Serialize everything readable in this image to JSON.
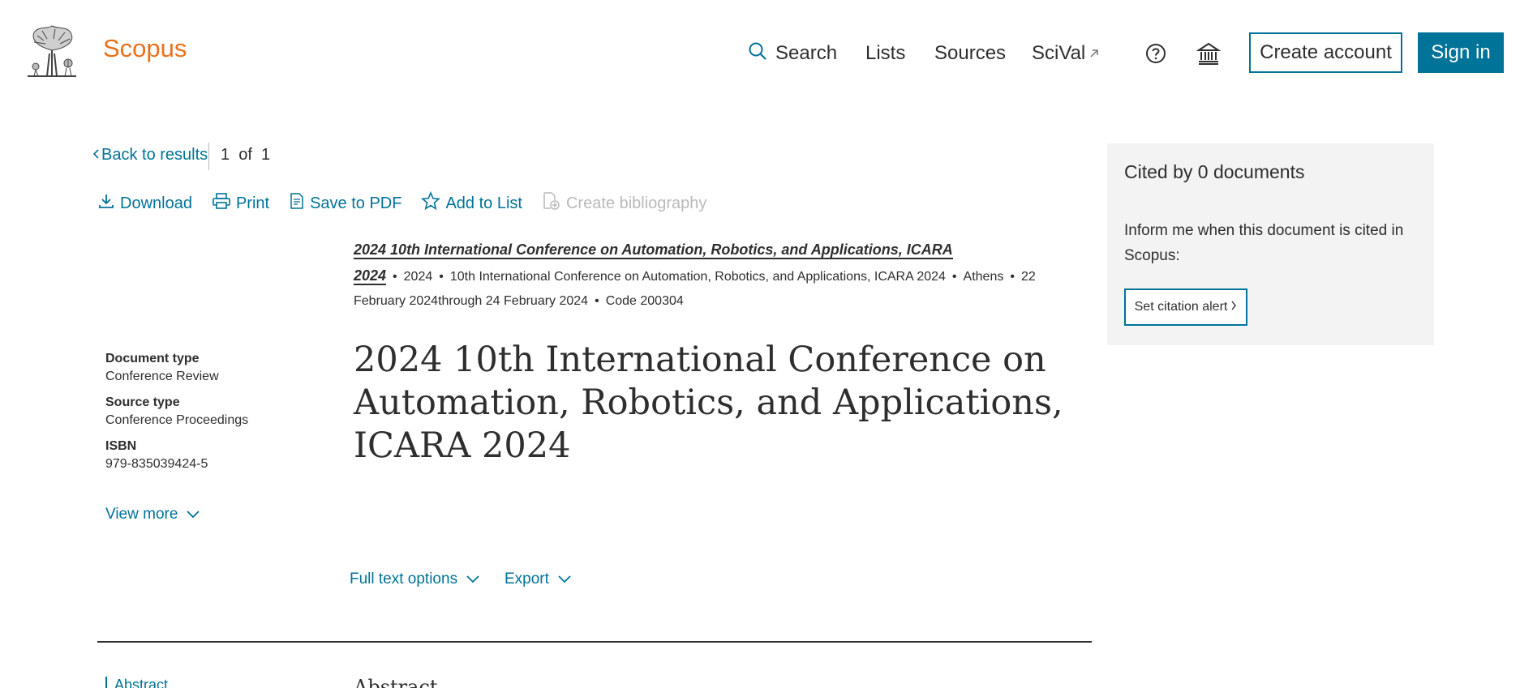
{
  "header": {
    "brand": "Scopus",
    "nav": {
      "search": "Search",
      "lists": "Lists",
      "sources": "Sources",
      "scival": "SciVal"
    },
    "create_account": "Create account",
    "sign_in": "Sign in",
    "icons": [
      "elsevier-logo",
      "search-icon",
      "external-link-icon",
      "help-icon",
      "institution-icon"
    ]
  },
  "back": {
    "label": "Back to results",
    "paging": "1  of  1"
  },
  "toolbar": {
    "download": "Download",
    "print": "Print",
    "save_pdf": "Save to PDF",
    "add_list": "Add to List",
    "create_bibliography": "Create bibliography"
  },
  "source": {
    "title": "2024 10th International Conference on Automation, Robotics, and Applications, ICARA 2024",
    "year": "2024",
    "edition_line": "10th International Conference on Automation, Robotics, and Applications, ICARA 2024",
    "location": "Athens",
    "dates": "22 February 2024through 24 February 2024",
    "code": "Code 200304"
  },
  "document": {
    "title": "2024 10th International Conference on Automation, Robotics, and Applications, ICARA 2024"
  },
  "meta": {
    "doc_type_label": "Document type",
    "doc_type_value": "Conference Review",
    "source_type_label": "Source type",
    "source_type_value": "Conference Proceedings",
    "isbn_label": "ISBN",
    "isbn_value": "979-835039424-5",
    "view_more": "View more"
  },
  "options": {
    "full_text": "Full text options",
    "export": "Export"
  },
  "abstract": {
    "side_link": "Abstract",
    "heading": "Abstract"
  },
  "cited": {
    "title": "Cited by 0 documents",
    "text": "Inform me when this document is cited in Scopus:",
    "alert_button": "Set citation alert"
  },
  "colors": {
    "brand": "#e9711c",
    "link": "#007398",
    "text": "#2e2e2e",
    "panel": "#f3f3f3",
    "disabled": "#b9b9b9"
  }
}
